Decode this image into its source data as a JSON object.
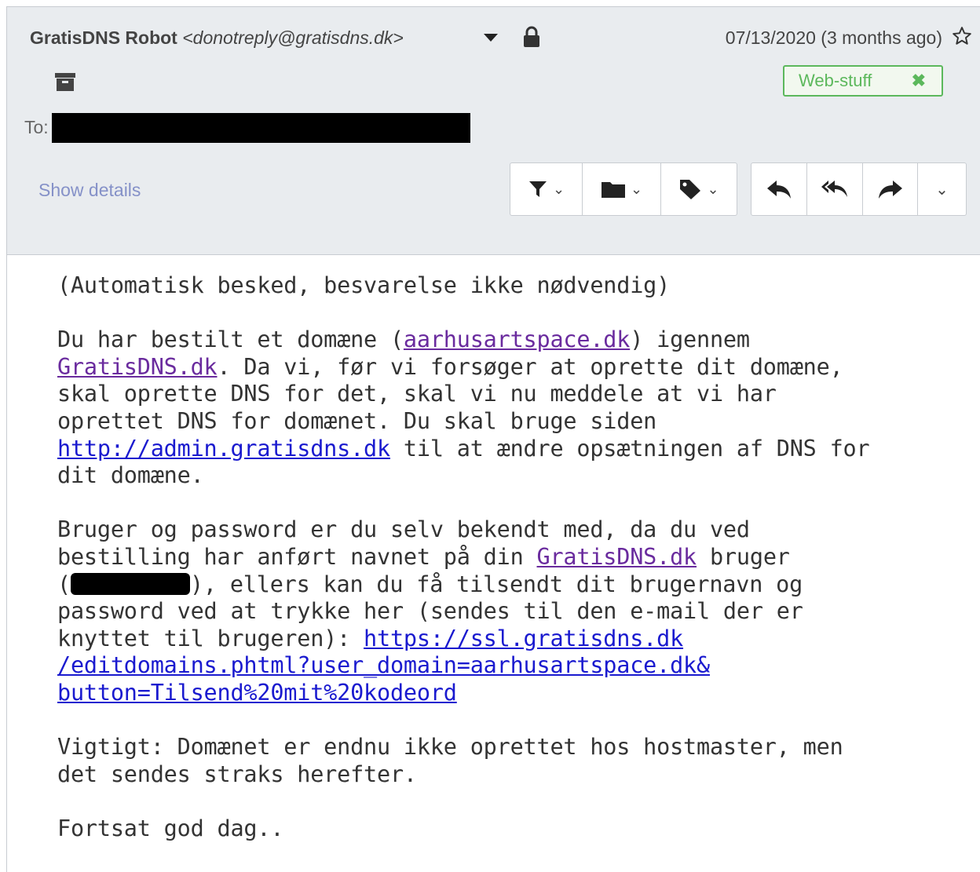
{
  "header": {
    "sender_name": "GratisDNS Robot",
    "sender_email": "<donotreply@gratisdns.dk>",
    "date": "07/13/2020 (3 months ago)",
    "to_label": "To:",
    "show_details": "Show details",
    "tag_label": "Web-stuff",
    "tag_remove": "✖",
    "colors": {
      "tag": "#5cb85c",
      "link": "#1a1acf",
      "visited_link": "#6a2b9e",
      "header_bg": "#e9ecef"
    }
  },
  "toolbar": {
    "filter_icon": "filter-icon",
    "folder_icon": "folder-icon",
    "tag_icon": "tag-icon",
    "reply_icon": "reply-icon",
    "reply_all_icon": "reply-all-icon",
    "forward_icon": "forward-icon",
    "more_icon": "chevron-down-icon"
  },
  "message": {
    "p1": "(Automatisk besked, besvarelse ikke nødvendig)",
    "p2_a": "Du har bestilt et domæne (",
    "p2_link1": "aarhusartspace.dk",
    "p2_b": ") igennem",
    "p2_link2": "GratisDNS.dk",
    "p2_c": ". Da vi, før vi forsøger at oprette dit domæne,\nskal oprette DNS for det, skal vi nu meddele at vi har\noprettet DNS for domænet. Du skal bruge siden\n",
    "p2_link3": "http://admin.gratisdns.dk",
    "p2_d": " til at ændre opsætningen af DNS for\ndit domæne.",
    "p3_a": "Bruger og password er du selv bekendt med, da du ved\nbestilling har anført navnet på din ",
    "p3_link1": "GratisDNS.dk",
    "p3_b": " bruger\n(",
    "p3_c": "), ellers kan du få tilsendt dit brugernavn og\npassword ved at trykke her (sendes til den e-mail der er\nknyttet til brugeren): ",
    "p3_link2": "https://ssl.gratisdns.dk\n/editdomains.phtml?user_domain=aarhusartspace.dk&\nbutton=Tilsend%20mit%20kodeord",
    "p4": "Vigtigt: Domænet er endnu ikke oprettet hos hostmaster, men\ndet sendes straks herefter.",
    "p5": "Fortsat god dag.."
  }
}
